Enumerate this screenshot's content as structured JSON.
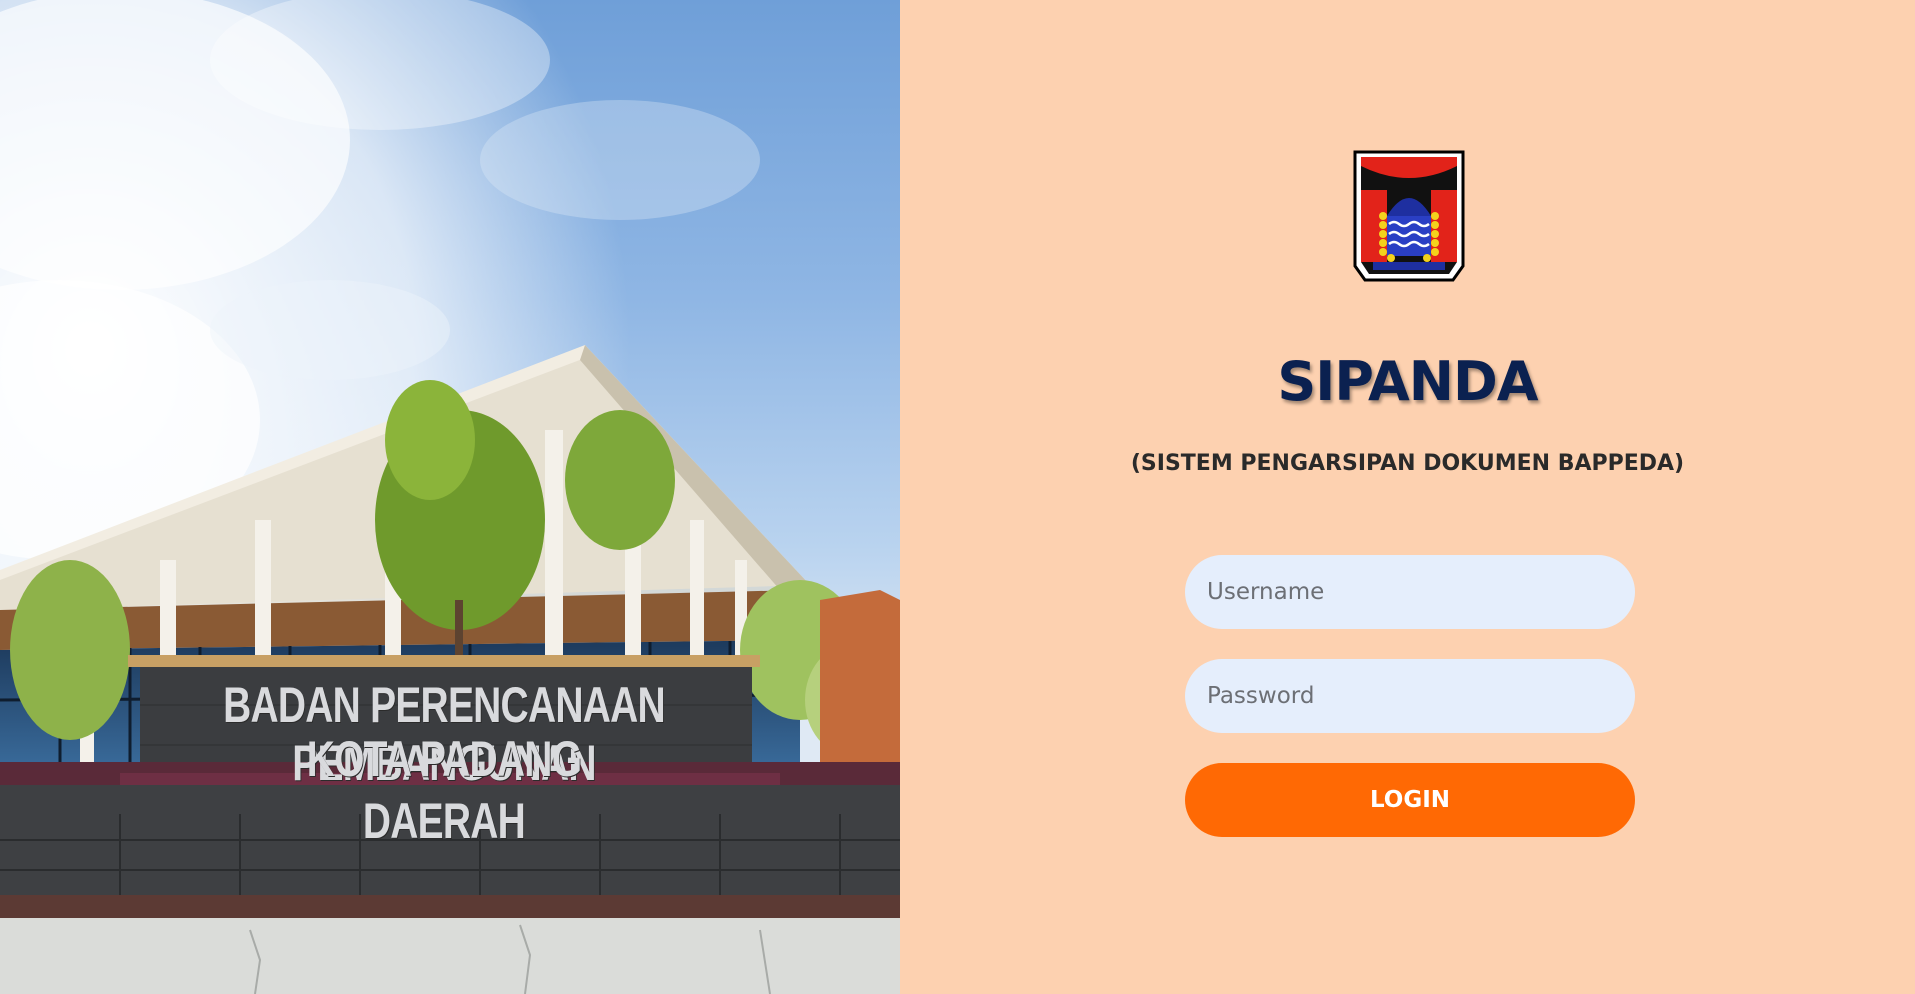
{
  "photo": {
    "sign_line_1": "BADAN PERENCANAAN PEMBANGUNAN DAERAH",
    "sign_line_2": "KOTA PADANG"
  },
  "login": {
    "title": "SIPANDA",
    "subtitle": "(SISTEM PENGARSIPAN DOKUMEN BAPPEDA)",
    "username_placeholder": "Username",
    "password_placeholder": "Password",
    "login_label": "LOGIN",
    "logo_icon": "padang-city-emblem-icon"
  },
  "colors": {
    "panel_background": "#fdd1b0",
    "title": "#0b2150",
    "input_background": "#e5eefc",
    "button": "#ff6904"
  }
}
